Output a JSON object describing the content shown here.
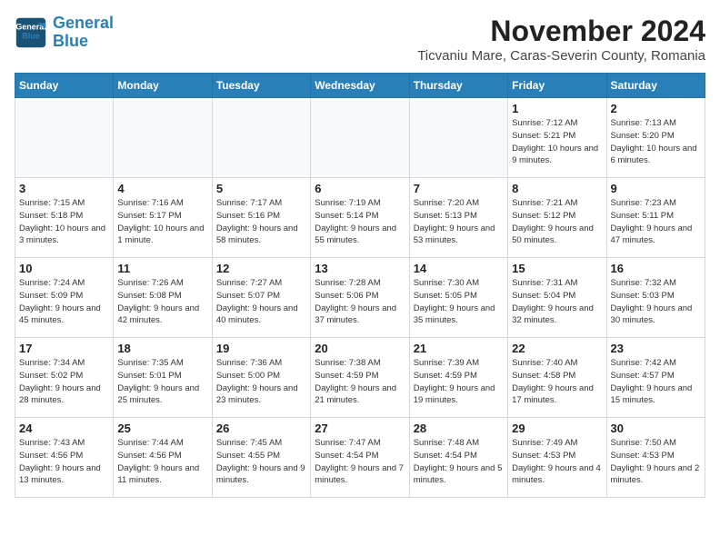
{
  "header": {
    "logo_line1": "General",
    "logo_line2": "Blue",
    "title": "November 2024",
    "subtitle": "Ticvaniu Mare, Caras-Severin County, Romania"
  },
  "weekdays": [
    "Sunday",
    "Monday",
    "Tuesday",
    "Wednesday",
    "Thursday",
    "Friday",
    "Saturday"
  ],
  "weeks": [
    [
      {
        "day": "",
        "info": ""
      },
      {
        "day": "",
        "info": ""
      },
      {
        "day": "",
        "info": ""
      },
      {
        "day": "",
        "info": ""
      },
      {
        "day": "",
        "info": ""
      },
      {
        "day": "1",
        "info": "Sunrise: 7:12 AM\nSunset: 5:21 PM\nDaylight: 10 hours and 9 minutes."
      },
      {
        "day": "2",
        "info": "Sunrise: 7:13 AM\nSunset: 5:20 PM\nDaylight: 10 hours and 6 minutes."
      }
    ],
    [
      {
        "day": "3",
        "info": "Sunrise: 7:15 AM\nSunset: 5:18 PM\nDaylight: 10 hours and 3 minutes."
      },
      {
        "day": "4",
        "info": "Sunrise: 7:16 AM\nSunset: 5:17 PM\nDaylight: 10 hours and 1 minute."
      },
      {
        "day": "5",
        "info": "Sunrise: 7:17 AM\nSunset: 5:16 PM\nDaylight: 9 hours and 58 minutes."
      },
      {
        "day": "6",
        "info": "Sunrise: 7:19 AM\nSunset: 5:14 PM\nDaylight: 9 hours and 55 minutes."
      },
      {
        "day": "7",
        "info": "Sunrise: 7:20 AM\nSunset: 5:13 PM\nDaylight: 9 hours and 53 minutes."
      },
      {
        "day": "8",
        "info": "Sunrise: 7:21 AM\nSunset: 5:12 PM\nDaylight: 9 hours and 50 minutes."
      },
      {
        "day": "9",
        "info": "Sunrise: 7:23 AM\nSunset: 5:11 PM\nDaylight: 9 hours and 47 minutes."
      }
    ],
    [
      {
        "day": "10",
        "info": "Sunrise: 7:24 AM\nSunset: 5:09 PM\nDaylight: 9 hours and 45 minutes."
      },
      {
        "day": "11",
        "info": "Sunrise: 7:26 AM\nSunset: 5:08 PM\nDaylight: 9 hours and 42 minutes."
      },
      {
        "day": "12",
        "info": "Sunrise: 7:27 AM\nSunset: 5:07 PM\nDaylight: 9 hours and 40 minutes."
      },
      {
        "day": "13",
        "info": "Sunrise: 7:28 AM\nSunset: 5:06 PM\nDaylight: 9 hours and 37 minutes."
      },
      {
        "day": "14",
        "info": "Sunrise: 7:30 AM\nSunset: 5:05 PM\nDaylight: 9 hours and 35 minutes."
      },
      {
        "day": "15",
        "info": "Sunrise: 7:31 AM\nSunset: 5:04 PM\nDaylight: 9 hours and 32 minutes."
      },
      {
        "day": "16",
        "info": "Sunrise: 7:32 AM\nSunset: 5:03 PM\nDaylight: 9 hours and 30 minutes."
      }
    ],
    [
      {
        "day": "17",
        "info": "Sunrise: 7:34 AM\nSunset: 5:02 PM\nDaylight: 9 hours and 28 minutes."
      },
      {
        "day": "18",
        "info": "Sunrise: 7:35 AM\nSunset: 5:01 PM\nDaylight: 9 hours and 25 minutes."
      },
      {
        "day": "19",
        "info": "Sunrise: 7:36 AM\nSunset: 5:00 PM\nDaylight: 9 hours and 23 minutes."
      },
      {
        "day": "20",
        "info": "Sunrise: 7:38 AM\nSunset: 4:59 PM\nDaylight: 9 hours and 21 minutes."
      },
      {
        "day": "21",
        "info": "Sunrise: 7:39 AM\nSunset: 4:59 PM\nDaylight: 9 hours and 19 minutes."
      },
      {
        "day": "22",
        "info": "Sunrise: 7:40 AM\nSunset: 4:58 PM\nDaylight: 9 hours and 17 minutes."
      },
      {
        "day": "23",
        "info": "Sunrise: 7:42 AM\nSunset: 4:57 PM\nDaylight: 9 hours and 15 minutes."
      }
    ],
    [
      {
        "day": "24",
        "info": "Sunrise: 7:43 AM\nSunset: 4:56 PM\nDaylight: 9 hours and 13 minutes."
      },
      {
        "day": "25",
        "info": "Sunrise: 7:44 AM\nSunset: 4:56 PM\nDaylight: 9 hours and 11 minutes."
      },
      {
        "day": "26",
        "info": "Sunrise: 7:45 AM\nSunset: 4:55 PM\nDaylight: 9 hours and 9 minutes."
      },
      {
        "day": "27",
        "info": "Sunrise: 7:47 AM\nSunset: 4:54 PM\nDaylight: 9 hours and 7 minutes."
      },
      {
        "day": "28",
        "info": "Sunrise: 7:48 AM\nSunset: 4:54 PM\nDaylight: 9 hours and 5 minutes."
      },
      {
        "day": "29",
        "info": "Sunrise: 7:49 AM\nSunset: 4:53 PM\nDaylight: 9 hours and 4 minutes."
      },
      {
        "day": "30",
        "info": "Sunrise: 7:50 AM\nSunset: 4:53 PM\nDaylight: 9 hours and 2 minutes."
      }
    ]
  ]
}
